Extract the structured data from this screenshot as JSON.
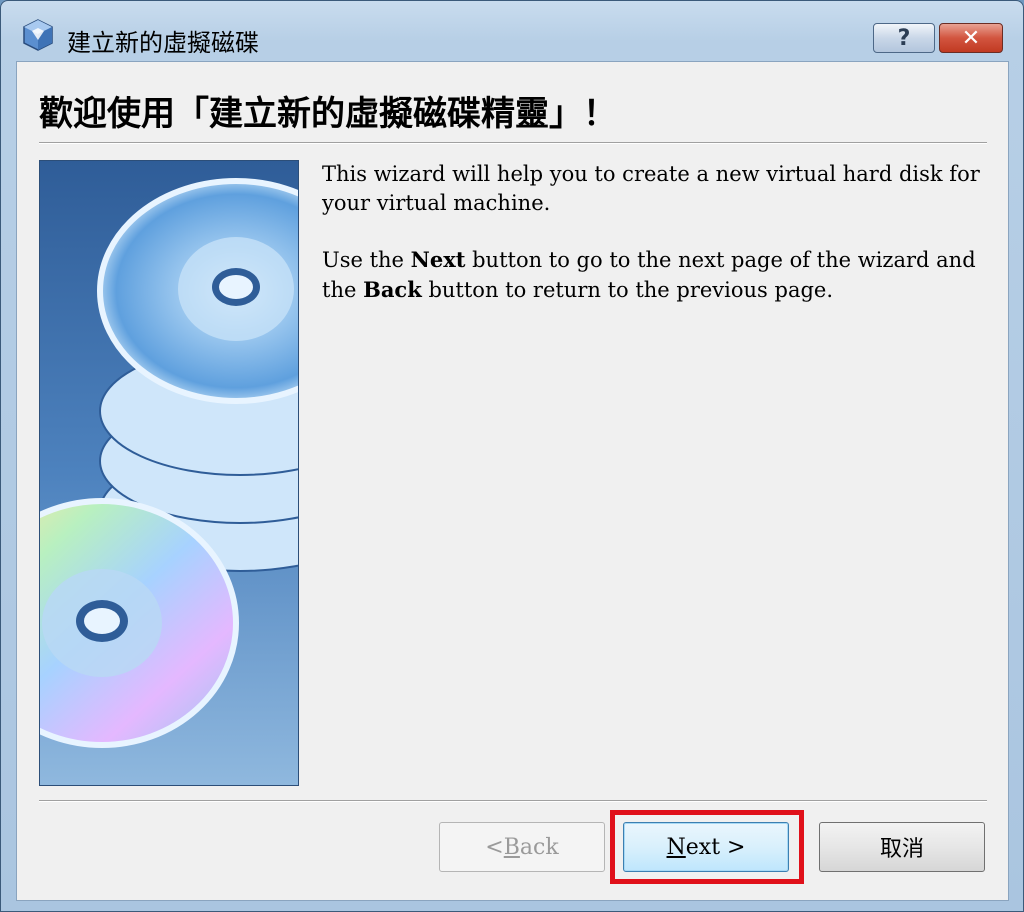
{
  "window": {
    "title": "建立新的虛擬磁碟",
    "help_label": "?",
    "close_label": "✕"
  },
  "wizard": {
    "heading": "歡迎使用「建立新的虛擬磁碟精靈」！",
    "para1": "This wizard will help you to create a new virtual hard disk for your virtual machine.",
    "para2": {
      "t1": "Use the ",
      "b1": "Next",
      "t2": " button to go to the next page of the wizard and the ",
      "b2": "Back",
      "t3": " button to return to the previous page."
    }
  },
  "buttons": {
    "back_prefix": "< ",
    "back_mnemonic": "B",
    "back_rest": "ack",
    "next_mnemonic": "N",
    "next_rest": "ext >",
    "cancel": "取消"
  },
  "colors": {
    "highlight": "#e0101a",
    "side_panel": "#3e6fa8"
  }
}
